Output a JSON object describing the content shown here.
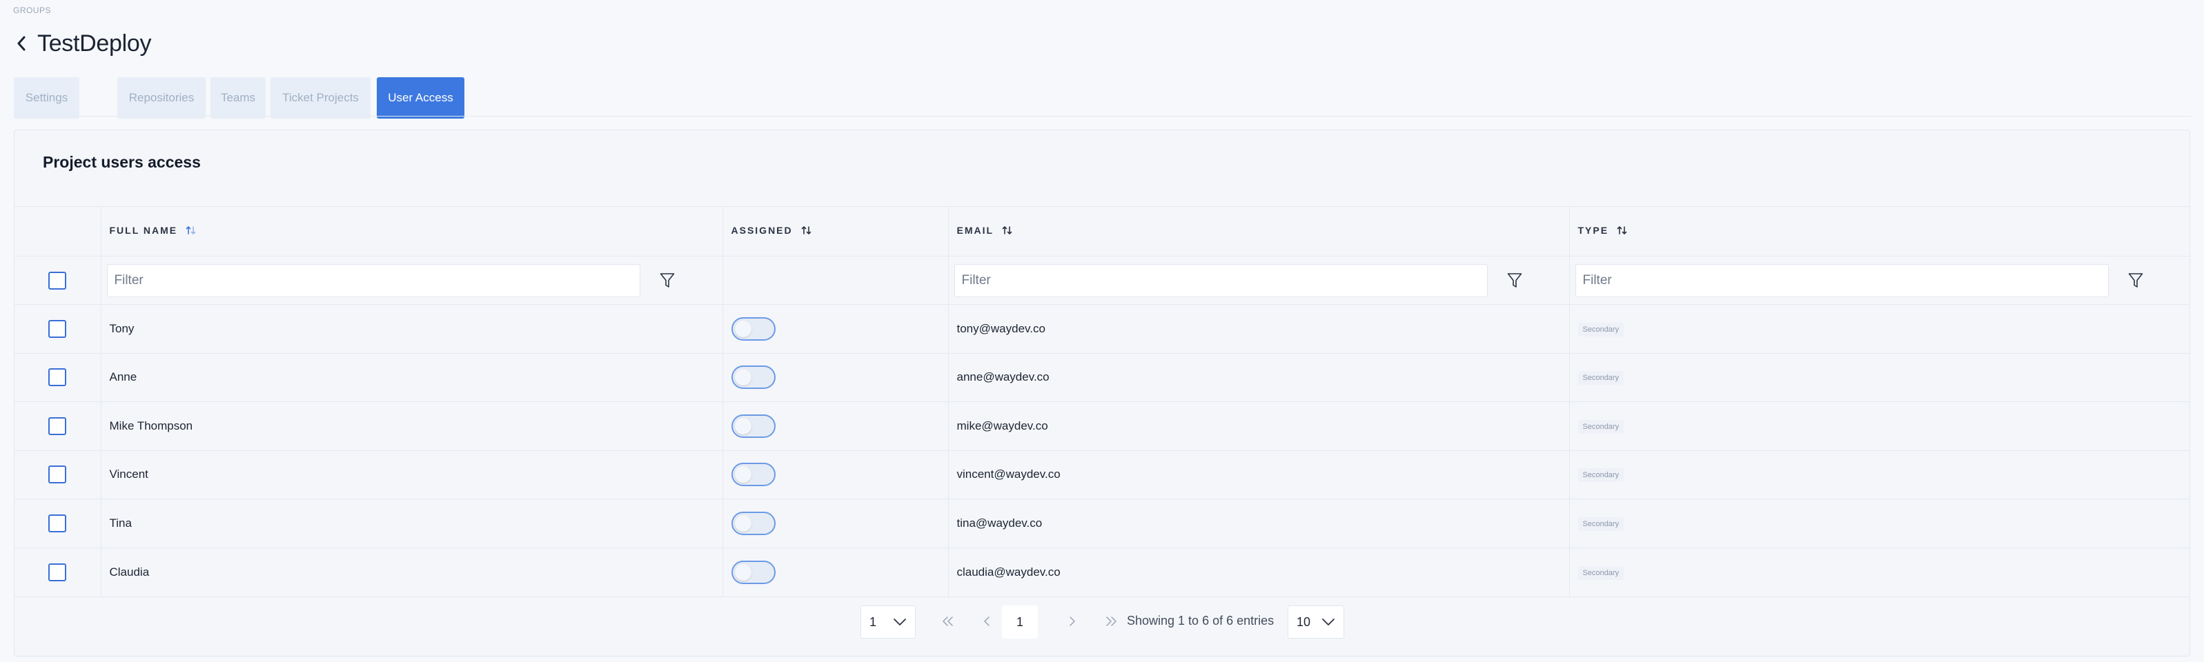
{
  "breadcrumb": "GROUPS",
  "page_title": "TestDeploy",
  "tabs": [
    {
      "label": "Settings"
    },
    {
      "label": "Repositories"
    },
    {
      "label": "Teams"
    },
    {
      "label": "Ticket Projects"
    },
    {
      "label": "User Access"
    }
  ],
  "active_tab": "User Access",
  "panel_title": "Project users access",
  "columns": {
    "full_name": "FULL NAME",
    "assigned": "ASSIGNED",
    "email": "EMAIL",
    "type": "TYPE"
  },
  "filter_placeholder": "Filter",
  "users": [
    {
      "name": "Tony",
      "email": "tony@waydev.co",
      "type": "Secondary"
    },
    {
      "name": "Anne",
      "email": "anne@waydev.co",
      "type": "Secondary"
    },
    {
      "name": "Mike Thompson",
      "email": "mike@waydev.co",
      "type": "Secondary"
    },
    {
      "name": "Vincent",
      "email": "vincent@waydev.co",
      "type": "Secondary"
    },
    {
      "name": "Tina",
      "email": "tina@waydev.co",
      "type": "Secondary"
    },
    {
      "name": "Claudia",
      "email": "claudia@waydev.co",
      "type": "Secondary"
    }
  ],
  "pagination": {
    "page_select": "1",
    "current_page": "1",
    "info": "Showing 1 to 6 of 6 entries",
    "page_size": "10"
  },
  "colors": {
    "accent": "#3d78e0",
    "tab_inactive_bg": "#e8eef7",
    "tab_inactive_text": "#9fb0c6"
  }
}
